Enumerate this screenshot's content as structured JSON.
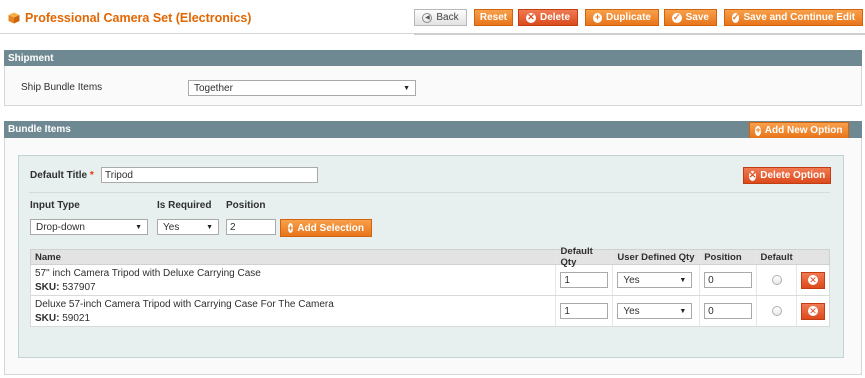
{
  "page": {
    "title": "Professional Camera Set (Electronics)",
    "title_icon": "cube-icon"
  },
  "toolbar": {
    "back": "Back",
    "reset": "Reset",
    "delete": "Delete",
    "duplicate": "Duplicate",
    "save": "Save",
    "save_continue": "Save and Continue Edit"
  },
  "shipment": {
    "header": "Shipment",
    "ship_label": "Ship Bundle Items",
    "ship_value": "Together"
  },
  "bundle": {
    "header": "Bundle Items",
    "add_option": "Add New Option",
    "option": {
      "default_title_label": "Default Title",
      "required_mark": "*",
      "default_title_value": "Tripod",
      "delete_option": "Delete Option",
      "input_type_label": "Input Type",
      "input_type_value": "Drop-down",
      "is_required_label": "Is Required",
      "is_required_value": "Yes",
      "position_label": "Position",
      "position_value": "2",
      "add_selection": "Add Selection"
    },
    "grid": {
      "headers": {
        "name": "Name",
        "default_qty": "Default Qty",
        "user_defined_qty": "User Defined Qty",
        "position": "Position",
        "default": "Default"
      },
      "sku_label": "SKU:",
      "rows": [
        {
          "name": "57\" inch Camera Tripod with Deluxe Carrying Case",
          "sku": "537907",
          "default_qty": "1",
          "user_defined_qty": "Yes",
          "position": "0",
          "is_default": false
        },
        {
          "name": "Deluxe 57-inch Camera Tripod with Carrying Case For The Camera",
          "sku": "59021",
          "default_qty": "1",
          "user_defined_qty": "Yes",
          "position": "0",
          "is_default": false
        }
      ]
    }
  },
  "colors": {
    "accent": "#e8751b",
    "title": "#e26703",
    "section_bar": "#6f8992",
    "danger": "#dc4a1c"
  }
}
